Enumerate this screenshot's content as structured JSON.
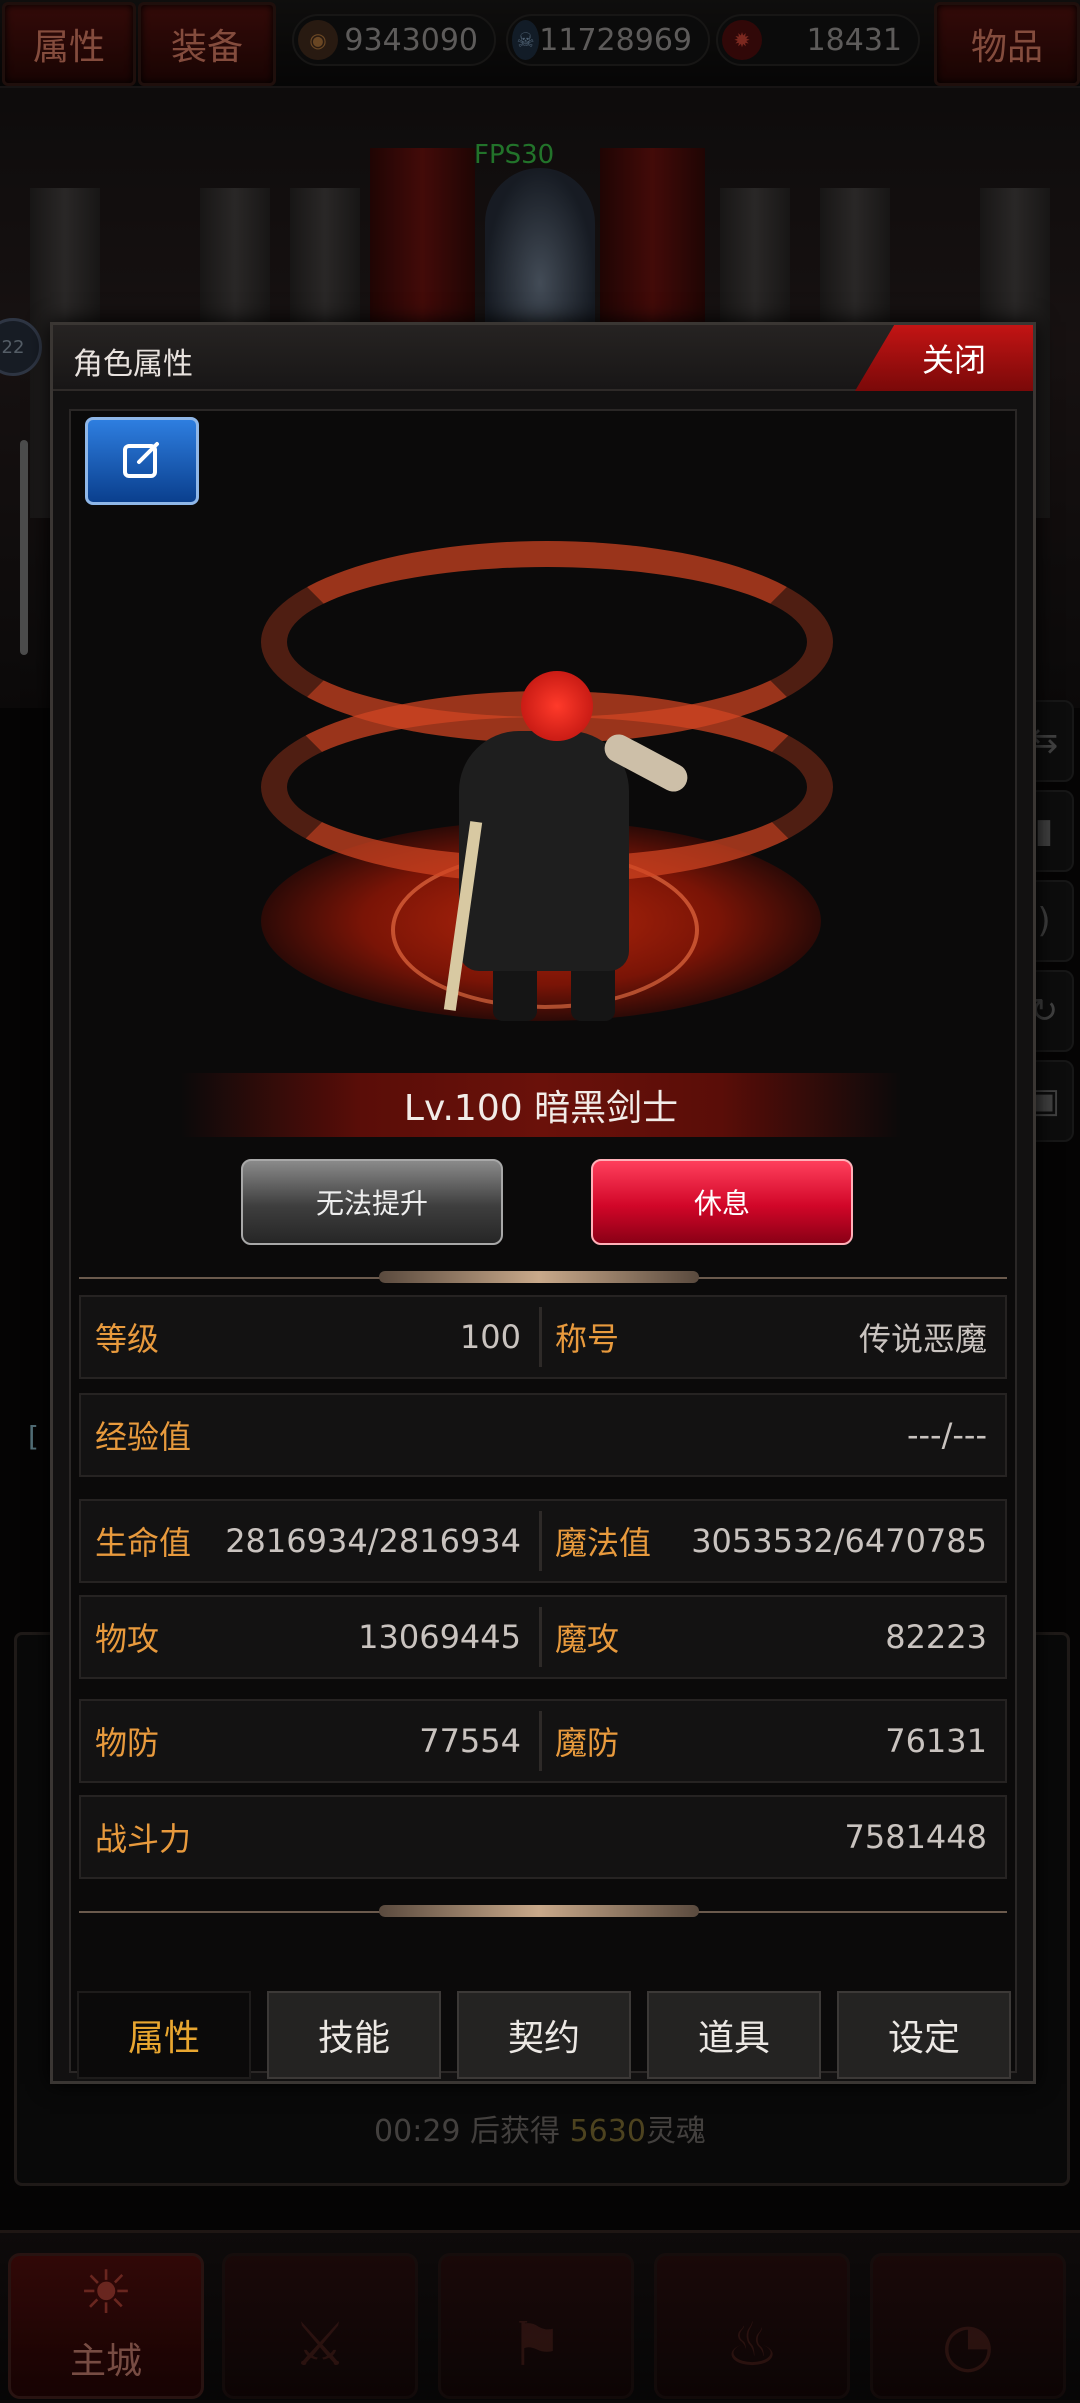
{
  "topbar": {
    "tab_attributes": "属性",
    "tab_equipment": "装备",
    "tab_items": "物品",
    "resources": [
      {
        "icon": "bronze-coin-icon",
        "value": "9343090"
      },
      {
        "icon": "blue-skull-gem-icon",
        "value": "11728969"
      },
      {
        "icon": "red-soul-icon",
        "value": "18431"
      }
    ]
  },
  "scene": {
    "fps": "FPS30",
    "badge": "22"
  },
  "dialog": {
    "title": "角色属性",
    "close": "关闭",
    "character": {
      "level_name": "Lv.100 暗黑剑士"
    },
    "buttons": {
      "upgrade": "无法提升",
      "rest": "休息"
    },
    "stats": {
      "level_label": "等级",
      "level_value": "100",
      "title_label": "称号",
      "title_value": "传说恶魔",
      "exp_label": "经验值",
      "exp_value": "---/---",
      "hp_label": "生命值",
      "hp_value": "2816934/2816934",
      "mp_label": "魔法值",
      "mp_value": "3053532/6470785",
      "patk_label": "物攻",
      "patk_value": "13069445",
      "matk_label": "魔攻",
      "matk_value": "82223",
      "pdef_label": "物防",
      "pdef_value": "77554",
      "mdef_label": "魔防",
      "mdef_value": "76131",
      "power_label": "战斗力",
      "power_value": "7581448"
    },
    "tabs": [
      "属性",
      "技能",
      "契约",
      "道具",
      "设定"
    ]
  },
  "timer": {
    "prefix": "00:29 后获得 ",
    "amount": "5630",
    "suffix": "灵魂"
  },
  "nav": {
    "main_city": "主城"
  },
  "colors": {
    "accent_red": "#c31414",
    "label_gold": "#e89a3d",
    "active_tab": "#e8a630"
  }
}
